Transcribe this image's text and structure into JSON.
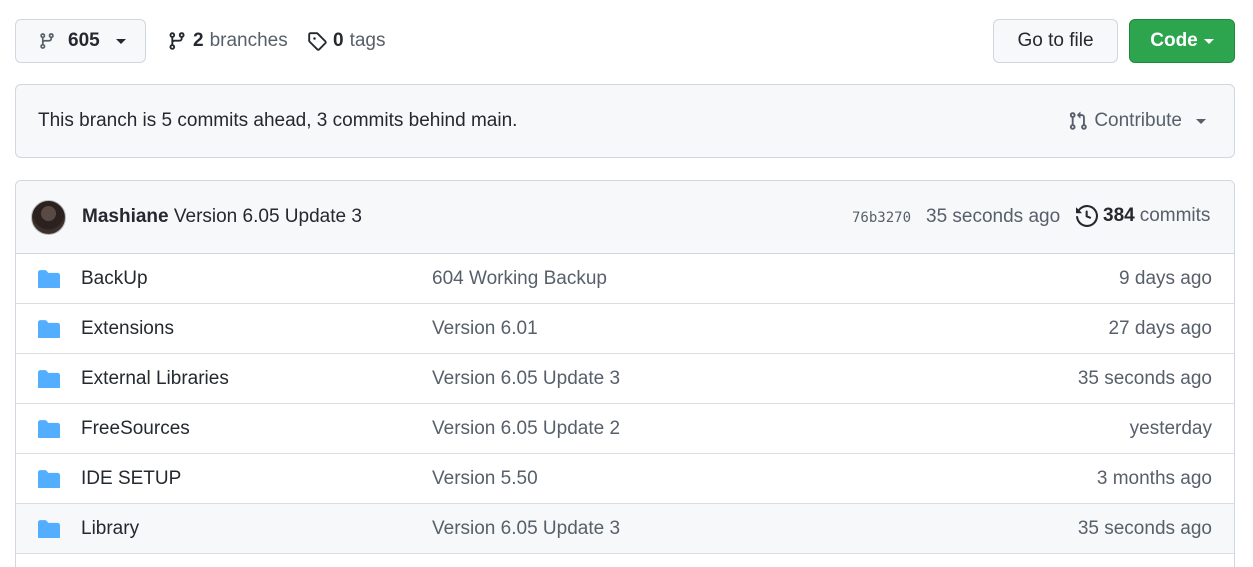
{
  "toolbar": {
    "branch_name": "605",
    "branches_count": "2",
    "branches_label": "branches",
    "tags_count": "0",
    "tags_label": "tags",
    "goto_file_label": "Go to file",
    "code_label": "Code"
  },
  "status": {
    "message": "This branch is 5 commits ahead, 3 commits behind main.",
    "contribute_label": "Contribute"
  },
  "latest_commit": {
    "author": "Mashiane",
    "message": "Version 6.05 Update 3",
    "sha": "76b3270",
    "time": "35 seconds ago",
    "commits_count": "384",
    "commits_label": "commits"
  },
  "files": [
    {
      "name": "BackUp",
      "message": "604 Working Backup",
      "age": "9 days ago"
    },
    {
      "name": "Extensions",
      "message": "Version 6.01",
      "age": "27 days ago"
    },
    {
      "name": "External Libraries",
      "message": "Version 6.05 Update 3",
      "age": "35 seconds ago"
    },
    {
      "name": "FreeSources",
      "message": "Version 6.05 Update 2",
      "age": "yesterday"
    },
    {
      "name": "IDE SETUP",
      "message": "Version 5.50",
      "age": "3 months ago"
    },
    {
      "name": "Library",
      "message": "Version 6.05 Update 3",
      "age": "35 seconds ago"
    }
  ],
  "colors": {
    "folder": "#54aeff",
    "code_button": "#2da44e",
    "muted_text": "#57606a",
    "border": "#d0d7de"
  }
}
